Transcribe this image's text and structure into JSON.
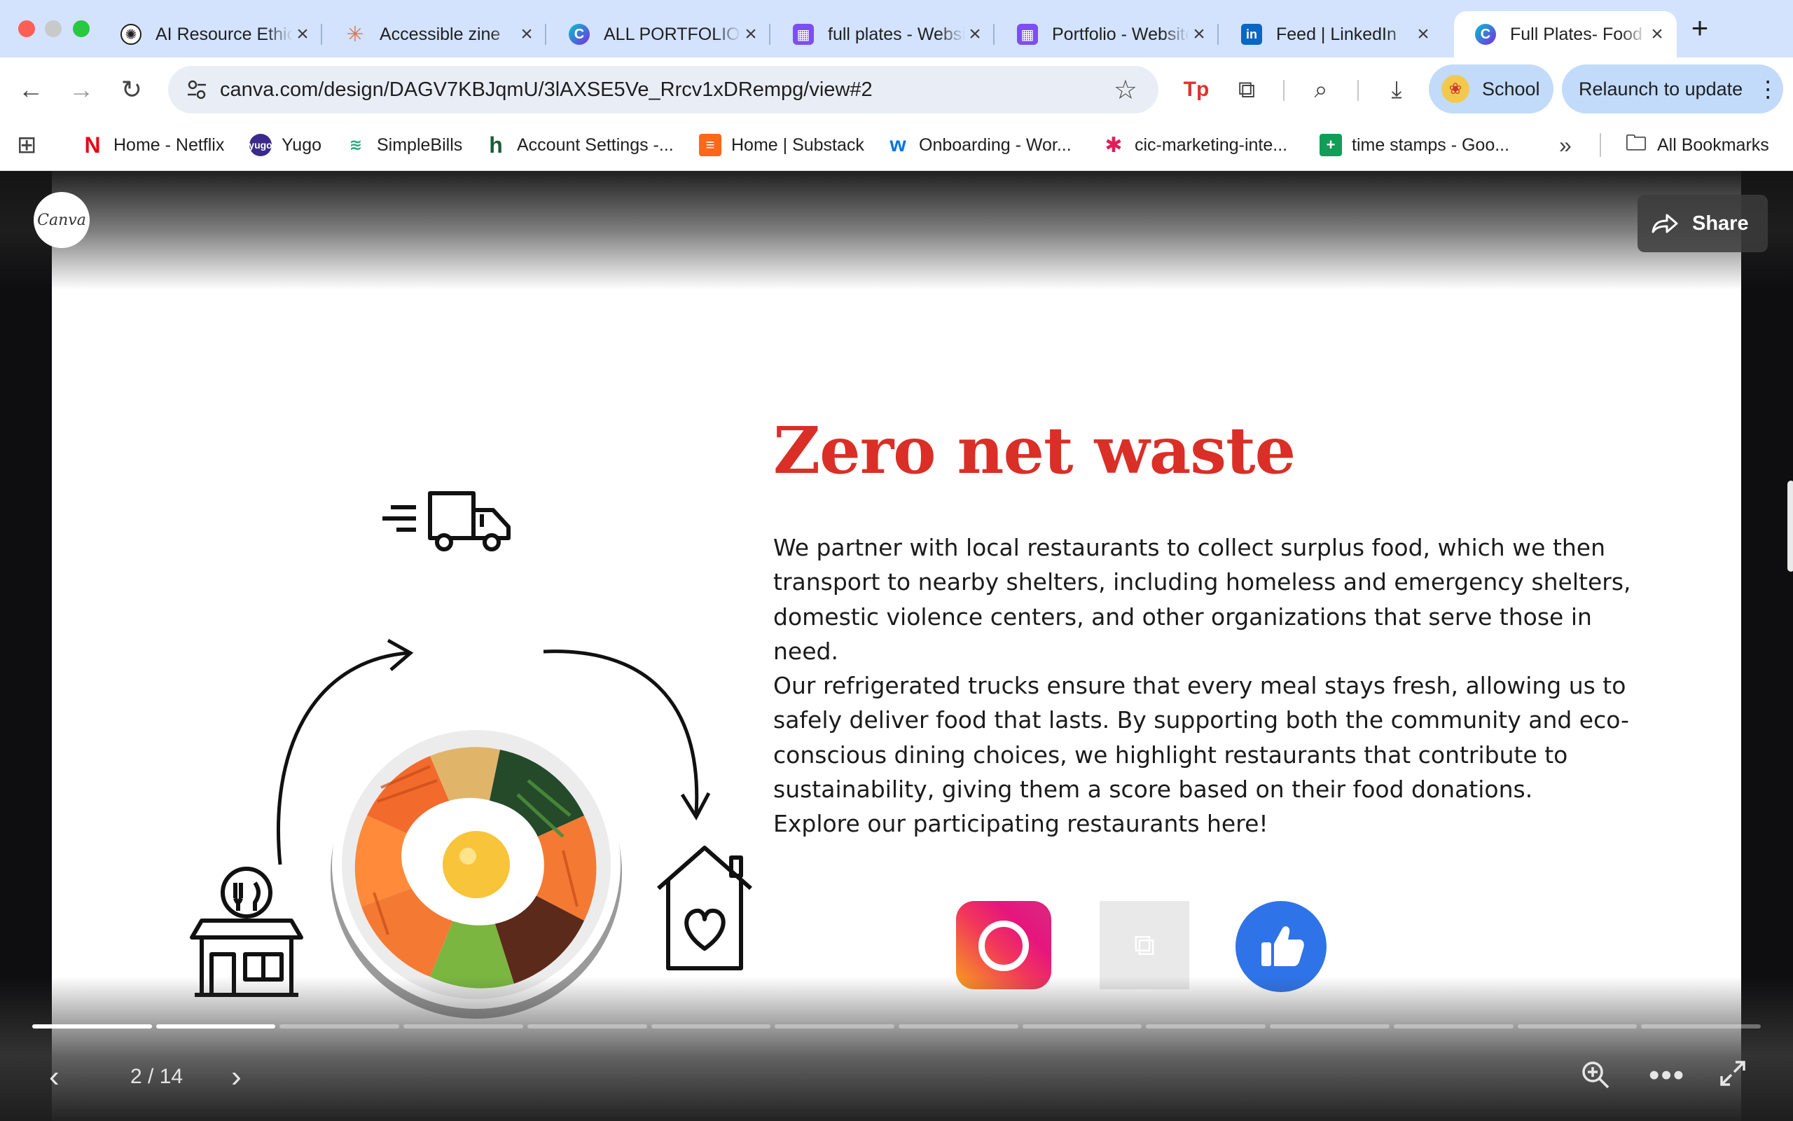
{
  "browser": {
    "tabs": [
      {
        "title": "AI Resource Ethics",
        "icon": "chatgpt-icon",
        "color": "#1f1f1f"
      },
      {
        "title": "Accessible zine",
        "icon": "claude-icon",
        "color": "#d97757"
      },
      {
        "title": "ALL PORTFOLIO",
        "icon": "canva-icon",
        "color": "#7d2ae8"
      },
      {
        "title": "full plates - Website",
        "icon": "calendar-icon",
        "color": "#7b4ff0"
      },
      {
        "title": "Portfolio - Website",
        "icon": "calendar-icon",
        "color": "#7b4ff0"
      },
      {
        "title": "Feed | LinkedIn",
        "icon": "linkedin-icon",
        "color": "#0a66c2"
      },
      {
        "title": "Full Plates- Food",
        "icon": "canva-icon",
        "color": "#7d2ae8"
      }
    ],
    "url": "canva.com/design/DAGV7KBJqmU/3lAXSE5Ve_Rrcv1xDRempg/view#2",
    "profile_label": "School",
    "relaunch_label": "Relaunch to update",
    "bookmarks": [
      {
        "label": "Home - Netflix",
        "icon": "netflix-icon",
        "color": "#e50914",
        "glyph": "N"
      },
      {
        "label": "Yugo",
        "icon": "yugo-icon",
        "color": "#3b2a8c",
        "glyph": "y"
      },
      {
        "label": "SimpleBills",
        "icon": "simplebills-icon",
        "color": "#2aa87a",
        "glyph": "≋"
      },
      {
        "label": "Account Settings -...",
        "icon": "houzz-icon",
        "color": "#1a5c3a",
        "glyph": "h"
      },
      {
        "label": "Home | Substack",
        "icon": "substack-icon",
        "color": "#ff6719",
        "glyph": "≡"
      },
      {
        "label": "Onboarding - Wor...",
        "icon": "workday-icon",
        "color": "#0875e1",
        "glyph": "w"
      },
      {
        "label": "cic-marketing-inte...",
        "icon": "slack-icon",
        "color": "#e01e5a",
        "glyph": "✱"
      },
      {
        "label": "time stamps - Goo...",
        "icon": "sheets-icon",
        "color": "#0f9d58",
        "glyph": "+"
      }
    ],
    "all_bookmarks_label": "All Bookmarks"
  },
  "viewer": {
    "logo_text": "Canva",
    "share_label": "Share",
    "slide": {
      "title": "Zero net waste",
      "paragraphs": [
        "We partner with local restaurants to collect surplus food, which we then transport to nearby shelters, including homeless and emergency shelters, domestic violence centers, and other organizations that serve those in need.",
        "Our refrigerated trucks ensure that every meal stays fresh, allowing us to safely deliver food that lasts. By supporting both the community and eco-conscious dining choices, we highlight restaurants that contribute to sustainability, giving them a score based on their food donations.",
        "Explore our participating restaurants here!"
      ]
    },
    "page_counter": "2 / 14",
    "current_page": 2,
    "total_pages": 14
  },
  "colors": {
    "title_red": "#d92f27",
    "tab_strip": "#d3e3fd",
    "pill_blue": "#c2dbfb"
  }
}
